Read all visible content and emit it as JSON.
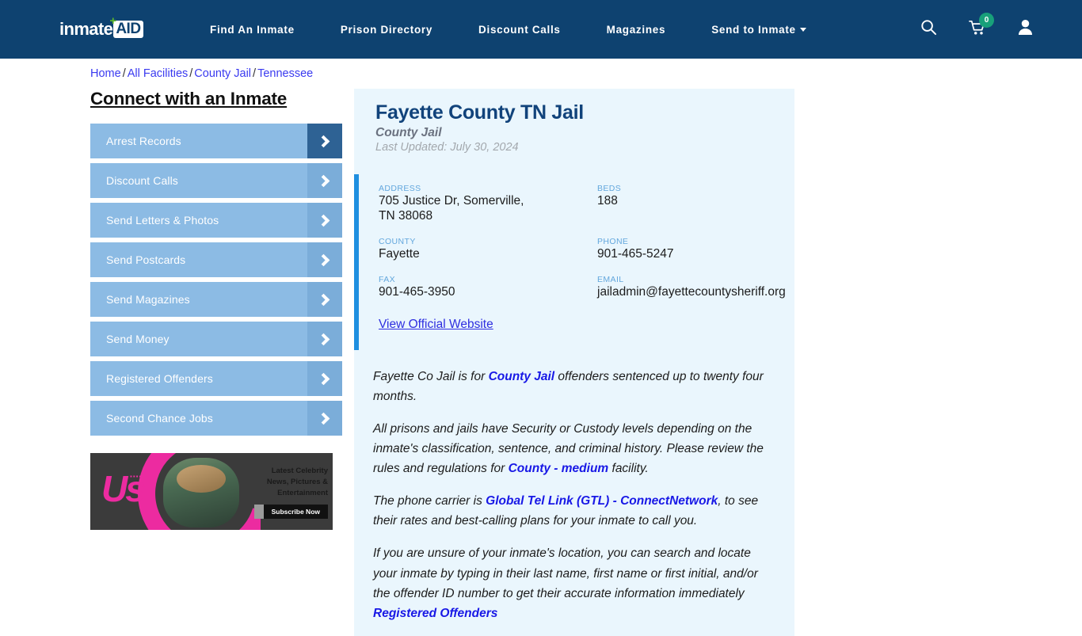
{
  "header": {
    "logo": {
      "word": "inmate",
      "badge": "AID",
      "plus": "+"
    },
    "nav": [
      {
        "label": "Find An Inmate",
        "has_caret": false
      },
      {
        "label": "Prison Directory",
        "has_caret": false
      },
      {
        "label": "Discount Calls",
        "has_caret": false
      },
      {
        "label": "Magazines",
        "has_caret": false
      },
      {
        "label": "Send to Inmate",
        "has_caret": true
      }
    ],
    "icons": {
      "search": "search-icon",
      "cart": "cart-icon",
      "cart_count": "0",
      "account": "user-icon"
    },
    "colors": {
      "background": "#0e4270",
      "badge_green": "#18a07a",
      "logo_plus_green": "#5cb82b"
    }
  },
  "breadcrumb": {
    "items": [
      "Home",
      "All Facilities",
      "County Jail",
      "Tennessee"
    ],
    "separator": "/"
  },
  "sidebar": {
    "title": "Connect with an Inmate",
    "items": [
      {
        "label": "Arrest Records",
        "active": true
      },
      {
        "label": "Discount Calls",
        "active": false
      },
      {
        "label": "Send Letters & Photos",
        "active": false
      },
      {
        "label": "Send Postcards",
        "active": false
      },
      {
        "label": "Send Magazines",
        "active": false
      },
      {
        "label": "Send Money",
        "active": false
      },
      {
        "label": "Registered Offenders",
        "active": false
      },
      {
        "label": "Second Chance Jobs",
        "active": false
      }
    ]
  },
  "ad": {
    "brand": "Us",
    "dots": "▪▪▪▪",
    "line1": "Latest Celebrity",
    "line2": "News, Pictures &",
    "line3": "Entertainment",
    "cta": "Subscribe Now"
  },
  "facility": {
    "title": "Fayette County TN Jail",
    "type": "County Jail",
    "last_updated": "Last Updated: July 30, 2024",
    "fields": [
      {
        "label": "ADDRESS",
        "value": "705 Justice Dr, Somerville, TN 38068"
      },
      {
        "label": "BEDS",
        "value": "188"
      },
      {
        "label": "COUNTY",
        "value": "Fayette"
      },
      {
        "label": "PHONE",
        "value": "901-465-5247"
      },
      {
        "label": "FAX",
        "value": "901-465-3950"
      },
      {
        "label": "EMAIL",
        "value": "jailadmin@fayettecountysheriff.org"
      }
    ],
    "official_website_link": "View Official Website",
    "accent_color": "#1f8fe0",
    "card_background": "#eaf6fd"
  },
  "body": {
    "p1_a": "Fayette Co Jail is for ",
    "p1_link": "County Jail",
    "p1_b": " offenders sentenced up to twenty four months.",
    "p2_a": "All prisons and jails have Security or Custody levels depending on the inmate's classification, sentence, and criminal history. Please review the rules and regulations for ",
    "p2_link": "County - medium",
    "p2_b": " facility.",
    "p3_a": "The phone carrier is ",
    "p3_link": "Global Tel Link (GTL) - ConnectNetwork",
    "p3_b": ", to see their rates and best-calling plans for your inmate to call you.",
    "p4_a": "If you are unsure of your inmate's location, you can search and locate your inmate by typing in their last name, first name or first initial, and/or the offender ID number to get their accurate information immediately ",
    "p4_link": "Registered Offenders"
  }
}
